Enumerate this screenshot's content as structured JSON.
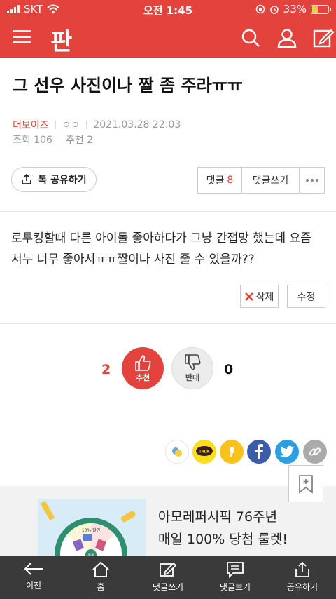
{
  "status_bar": {
    "carrier": "SKT",
    "time": "오전 1:45",
    "battery": "33%"
  },
  "app": {
    "logo_text": "판",
    "brand_color": "#e4433d",
    "icons": [
      "menu-icon",
      "search-icon",
      "user-icon",
      "write-icon"
    ]
  },
  "post": {
    "title": "그 선우 사진이나 짤 좀 주라ㅠㅠ",
    "author": "더보이즈",
    "author_sub": "ㅇㅇ",
    "date": "2021.03.28 22:03",
    "views_label": "조회 106",
    "recommend_label": "추천 2",
    "body_line1": "로투킹할때 다른 아이돌 좋아하다가 그냥 간잽망 했는데 요즘",
    "body_line2": "서누 너무 좋아서ㅠㅠ짤이나 사진 줄 수 있을까??"
  },
  "actions": {
    "share_label": "톡 공유하기",
    "comments_label": "댓글",
    "comments_count": "8",
    "write_comment_label": "댓글쓰기",
    "delete_label": "삭제",
    "edit_label": "수정"
  },
  "votes": {
    "up_count": "2",
    "up_label": "추천",
    "down_count": "0",
    "down_label": "반대"
  },
  "social_icons": [
    "kakaostory-icon",
    "kakaotalk-icon",
    "kakao-quote-icon",
    "facebook-icon",
    "twitter-icon",
    "link-icon"
  ],
  "kakaotalk_text": "TALK",
  "ad": {
    "line1": "아모레퍼시픽 76주년",
    "line2": "매일 100% 당첨 룰렛!",
    "wheel_label1": "10% 할인",
    "wheel_label2": "쿠폰"
  },
  "bottom_nav": [
    {
      "label": "이전",
      "icon": "back-arrow-icon"
    },
    {
      "label": "홈",
      "icon": "home-icon"
    },
    {
      "label": "댓글쓰기",
      "icon": "write-comment-icon"
    },
    {
      "label": "댓글보기",
      "icon": "view-comments-icon"
    },
    {
      "label": "공유하기",
      "icon": "share-icon"
    }
  ]
}
